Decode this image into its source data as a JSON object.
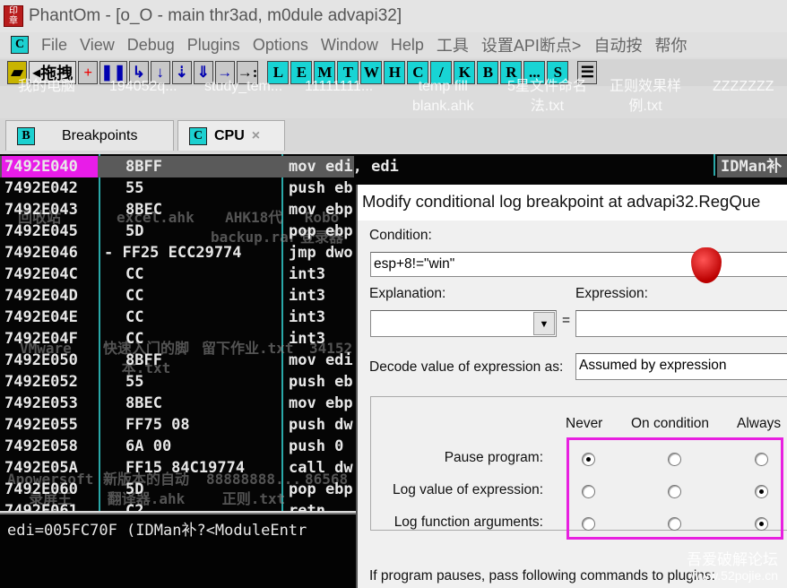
{
  "window": {
    "title": "PhantOm - [o_O - main thr3ad, m0dule advapi32]",
    "icon": "app-icon-seal"
  },
  "menu": {
    "c_icon": "C",
    "items": [
      "File",
      "View",
      "Debug",
      "Plugins",
      "Options",
      "Window",
      "Help",
      "工具",
      "设置API断点>",
      "自动按",
      "帮你"
    ]
  },
  "toolbar": {
    "drag_label": "拖拽",
    "letters": [
      "L",
      "E",
      "M",
      "T",
      "W",
      "H",
      "C",
      "/",
      "K",
      "B",
      "R",
      "...",
      "S"
    ]
  },
  "desktop_labels": [
    "我的电脑",
    "194052q...",
    "study_tem...",
    "11111111...",
    "temp fill\nblank.ahk",
    "5星文件命名\n法.txt",
    "正则效果样\n例.txt",
    "ZZZZZZZ",
    "回收站",
    "excel.ahk",
    "AHK18代\nbackup.rar",
    "Robo\n登录器",
    "VMware",
    "快速入门的脚\n本.txt",
    "留下作业.txt",
    "34152",
    "Apowersoft\n录屏王",
    "新版本的自动\n翻译器.ahk",
    "88888888...\n正则.txt",
    "86568"
  ],
  "tabs": [
    {
      "icon": "B",
      "label": "Breakpoints"
    },
    {
      "icon": "C",
      "label": "CPU",
      "close": "×"
    }
  ],
  "disasm": [
    {
      "addr": "7492E040",
      "hex": "8BFF",
      "asm": "mov edi, edi",
      "comment": "IDMan补",
      "selected": true
    },
    {
      "addr": "7492E042",
      "hex": "55",
      "asm": "push eb"
    },
    {
      "addr": "7492E043",
      "hex": "8BEC",
      "asm": "mov ebp"
    },
    {
      "addr": "7492E045",
      "hex": "5D",
      "asm": "pop ebp"
    },
    {
      "addr": "7492E046",
      "hex": "- FF25 ECC29774",
      "asm": "jmp dwo"
    },
    {
      "addr": "7492E04C",
      "hex": "CC",
      "asm": "int3"
    },
    {
      "addr": "7492E04D",
      "hex": "CC",
      "asm": "int3"
    },
    {
      "addr": "7492E04E",
      "hex": "CC",
      "asm": "int3"
    },
    {
      "addr": "7492E04F",
      "hex": "CC",
      "asm": "int3"
    },
    {
      "addr": "7492E050",
      "hex": "8BFF",
      "asm": "mov edi"
    },
    {
      "addr": "7492E052",
      "hex": "55",
      "asm": "push eb"
    },
    {
      "addr": "7492E053",
      "hex": "8BEC",
      "asm": "mov ebp"
    },
    {
      "addr": "7492E055",
      "hex": "FF75 08",
      "asm": "push dw"
    },
    {
      "addr": "7492E058",
      "hex": "6A 00",
      "asm": "push 0"
    },
    {
      "addr": "7492E05A",
      "hex": "FF15 84C19774",
      "asm": "call dw"
    },
    {
      "addr": "7492E060",
      "hex": "5D",
      "asm": "pop ebp"
    },
    {
      "addr": "7492E061",
      "hex": "C2",
      "asm": "retn"
    }
  ],
  "info": {
    "line": "edi=005FC70F (IDMan补?<ModuleEntr"
  },
  "dialog": {
    "title": "Modify conditional log breakpoint at advapi32.RegQue",
    "condition_label": "Condition:",
    "condition_value": "esp+8!=\"win\"",
    "explanation_label": "Explanation:",
    "explanation_value": "",
    "equals": "=",
    "expression_label": "Expression:",
    "expression_value": "",
    "decode_label": "Decode value of expression as:",
    "decode_value": "Assumed by expression",
    "columns": [
      "Never",
      "On condition",
      "Always"
    ],
    "rows": [
      {
        "label": "Pause program:",
        "selected": 0
      },
      {
        "label": "Log value of expression:",
        "selected": 2
      },
      {
        "label": "Log function arguments:",
        "selected": 2
      }
    ],
    "plugins_label": "If program pauses, pass following commands to plugins:",
    "highlight_color": "#e820e0"
  },
  "watermark": {
    "line1": "吾爱破解论坛",
    "line2": "www.52pojie.cn"
  }
}
